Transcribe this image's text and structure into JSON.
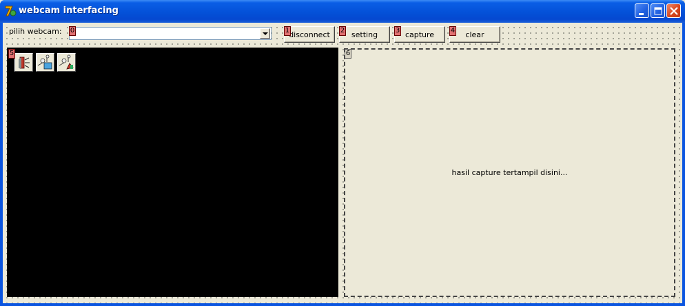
{
  "window": {
    "title": "webcam interfacing"
  },
  "toolbar": {
    "webcam_label": "pilih webcam:",
    "webcam_select_value": "",
    "tags": [
      "0",
      "1",
      "2",
      "3",
      "4",
      "5",
      "6"
    ],
    "buttons": [
      "disconnect",
      "setting",
      "capture",
      "clear"
    ]
  },
  "video_panel": {
    "icons": [
      "video-source-icon",
      "video-display-icon",
      "video-format-icon"
    ]
  },
  "capture_panel": {
    "placeholder": "hasil capture tertampil disini..."
  }
}
